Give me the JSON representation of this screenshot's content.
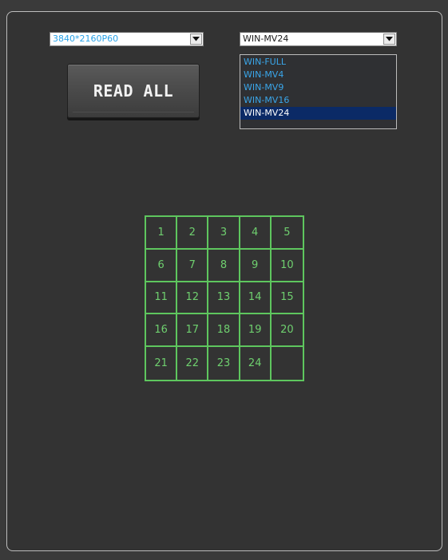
{
  "resolution": {
    "value": "3840*2160P60"
  },
  "mode": {
    "value": "WIN-MV24",
    "options": [
      "WIN-FULL",
      "WIN-MV4",
      "WIN-MV9",
      "WIN-MV16",
      "WIN-MV24"
    ],
    "selected_index": 4
  },
  "read_all_label": "READ ALL",
  "grid": {
    "cells": [
      "1",
      "2",
      "3",
      "4",
      "5",
      "6",
      "7",
      "8",
      "9",
      "10",
      "11",
      "12",
      "13",
      "14",
      "15",
      "16",
      "17",
      "18",
      "19",
      "20",
      "21",
      "22",
      "23",
      "24",
      ""
    ]
  },
  "colors": {
    "background": "#333333",
    "grid_line": "#5ec65e",
    "grid_text": "#6fd06f",
    "link_text": "#2aa3e8",
    "selected_option_bg": "#0b2a66"
  }
}
